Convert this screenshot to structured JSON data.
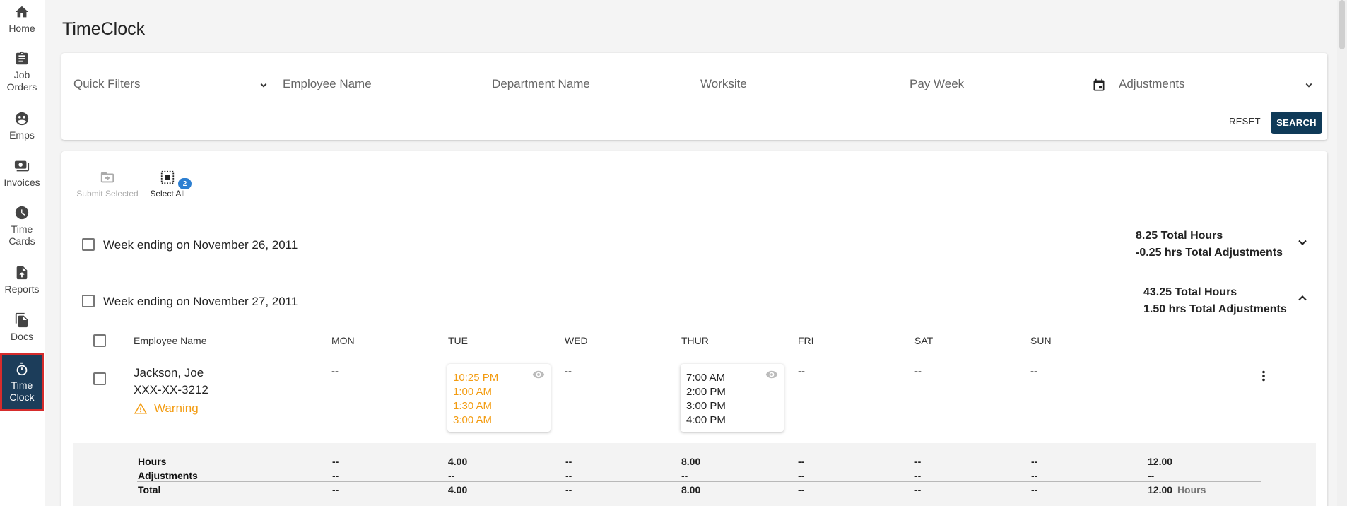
{
  "app": {
    "title": "TimeClock"
  },
  "sidebar": {
    "items": [
      {
        "label": "Home",
        "icon": "home-icon"
      },
      {
        "label": "Job\nOrders",
        "icon": "clipboard-icon"
      },
      {
        "label": "Emps",
        "icon": "people-icon"
      },
      {
        "label": "Invoices",
        "icon": "money-icon"
      },
      {
        "label": "Time\nCards",
        "icon": "clock-icon"
      },
      {
        "label": "Reports",
        "icon": "upload-file-icon"
      },
      {
        "label": "Docs",
        "icon": "files-icon"
      },
      {
        "label": "Time\nClock",
        "icon": "stopwatch-icon",
        "active": true
      }
    ]
  },
  "filters": {
    "quick_filters": "Quick Filters",
    "employee_name": "Employee Name",
    "department_name": "Department Name",
    "worksite": "Worksite",
    "pay_week": "Pay Week",
    "adjustments": "Adjustments",
    "reset": "RESET",
    "search": "SEARCH"
  },
  "actions": {
    "submit_selected": "Submit Selected",
    "select_all": "Select All",
    "selected_count": "2"
  },
  "weeks": [
    {
      "label": "Week ending on November 26, 2011",
      "total_hours": "8.25 Total Hours",
      "total_adjustments": "-0.25 hrs Total Adjustments",
      "expanded": false
    },
    {
      "label": "Week ending on November 27, 2011",
      "total_hours": "43.25 Total Hours",
      "total_adjustments": "1.50 hrs Total Adjustments",
      "expanded": true
    }
  ],
  "grid": {
    "headers": {
      "employee": "Employee Name",
      "mon": "MON",
      "tue": "TUE",
      "wed": "WED",
      "thur": "THUR",
      "fri": "FRI",
      "sat": "SAT",
      "sun": "SUN"
    },
    "row": {
      "name": "Jackson, Joe",
      "ssn": "XXX-XX-3212",
      "warning": "Warning",
      "mon": "--",
      "tue_punches": [
        "10:25 PM",
        "1:00 AM",
        "1:30 AM",
        "3:00 AM"
      ],
      "wed": "--",
      "thur_punches": [
        "7:00 AM",
        "2:00 PM",
        "3:00 PM",
        "4:00 PM"
      ],
      "fri": "--",
      "sat": "--",
      "sun": "--"
    },
    "summary": {
      "labels": {
        "hours": "Hours",
        "adjustments": "Adjustments",
        "total": "Total"
      },
      "hours": {
        "mon": "--",
        "tue": "4.00",
        "wed": "--",
        "thur": "8.00",
        "fri": "--",
        "sat": "--",
        "sun": "--",
        "total": "12.00"
      },
      "adjustments": {
        "mon": "--",
        "tue": "--",
        "wed": "--",
        "thur": "--",
        "fri": "--",
        "sat": "--",
        "sun": "--",
        "total": "--"
      },
      "total": {
        "mon": "--",
        "tue": "4.00",
        "wed": "--",
        "thur": "8.00",
        "fri": "--",
        "sat": "--",
        "sun": "--",
        "total": "12.00",
        "unit": "Hours"
      }
    }
  },
  "colors": {
    "primary": "#0f3a58",
    "warning": "#f39c12",
    "badge": "#2d7fd1",
    "active_outline": "#d62c2c"
  }
}
